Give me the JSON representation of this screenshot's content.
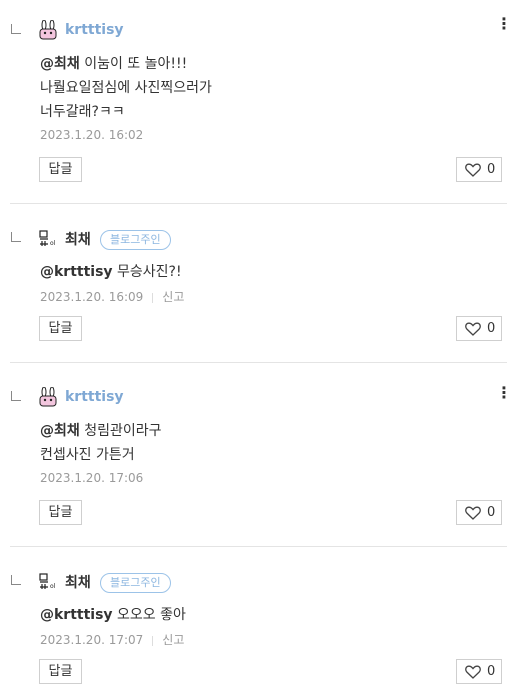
{
  "comments": [
    {
      "author": "krtttisy",
      "owner_badge": "",
      "mention": "@최채",
      "lines": [
        "이눔이 또 놀아!!!",
        "나뤌요일점심에 사진찍으러가",
        "너두갈래?ㅋㅋ"
      ],
      "date": "2023.1.20. 16:02",
      "report": "",
      "reply_label": "답글",
      "likes": "0",
      "avatar": "bunny-avatar"
    },
    {
      "author": "최채",
      "owner_badge": "블로그주인",
      "mention": "@krtttisy",
      "lines": [
        "무승사진?!"
      ],
      "date": "2023.1.20. 16:09",
      "report": "신고",
      "reply_label": "답글",
      "likes": "0",
      "avatar": "sketch-avatar"
    },
    {
      "author": "krtttisy",
      "owner_badge": "",
      "mention": "@최채",
      "lines": [
        "청림관이라구",
        "컨셉사진 가튼거"
      ],
      "date": "2023.1.20. 17:06",
      "report": "",
      "reply_label": "답글",
      "likes": "0",
      "avatar": "bunny-avatar"
    },
    {
      "author": "최채",
      "owner_badge": "블로그주인",
      "mention": "@krtttisy",
      "lines": [
        "오오오 좋아"
      ],
      "date": "2023.1.20. 17:07",
      "report": "신고",
      "reply_label": "답글",
      "likes": "0",
      "avatar": "sketch-avatar"
    }
  ],
  "icons": {
    "more": "more-vertical-icon",
    "like": "heart-icon",
    "reply": "reply-arrow-icon"
  },
  "colors": {
    "author_link": "#7fa8d4",
    "badge": "#8cb6e0",
    "meta": "#9a9a9a"
  }
}
